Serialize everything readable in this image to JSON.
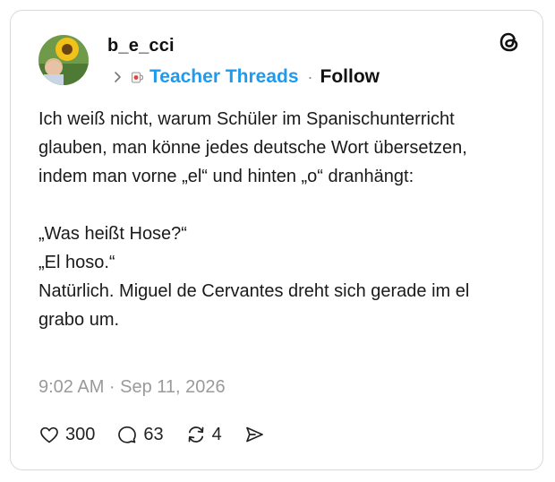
{
  "post": {
    "author": "b_e_cci",
    "community": "Teacher Threads",
    "separator": "·",
    "follow_label": "Follow",
    "text_paragraphs": [
      "Ich weiß nicht, warum Schüler im Spanischunterricht glauben, man könne jedes deutsche Wort übersetzen, indem man vorne „el“ und hinten „o“ dranhängt:"
    ],
    "text_lines_2": [
      "„Was heißt Hose?“",
      "„El hoso.“",
      "Natürlich. Miguel de Cervantes dreht sich gerade im el grabo um."
    ],
    "timestamp": "9:02 AM · Sep 11, 2026"
  },
  "actions": {
    "likes": "300",
    "replies": "63",
    "reposts": "4"
  },
  "icons": {
    "avatar": "avatar-sunflower-photo",
    "logo": "threads-logo-icon",
    "chevron": "chevron-right-icon",
    "community_icon": "mug-icon",
    "like": "heart-icon",
    "reply": "speech-bubble-icon",
    "repost": "repost-icon",
    "share": "send-icon"
  },
  "colors": {
    "community": "#1d9bf0",
    "timestamp": "#9a9a9a",
    "border": "#d9d9d9"
  }
}
